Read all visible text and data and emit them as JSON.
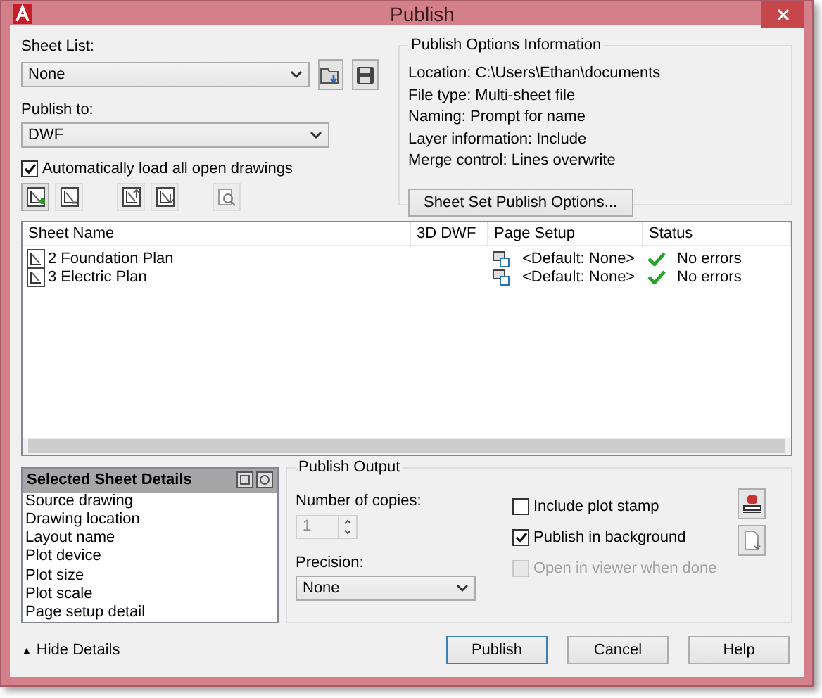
{
  "window": {
    "title": "Publish"
  },
  "sheet_list": {
    "label": "Sheet List:",
    "value": "None"
  },
  "publish_to": {
    "label": "Publish to:",
    "value": "DWF"
  },
  "auto_load": {
    "label": "Automatically load all open drawings",
    "checked": true
  },
  "options_info": {
    "title": "Publish Options Information",
    "lines": [
      "Location: C:\\Users\\Ethan\\documents",
      "File type: Multi-sheet file",
      "Naming: Prompt for name",
      "Layer information: Include",
      "Merge control: Lines overwrite"
    ],
    "button": "Sheet Set Publish Options..."
  },
  "table": {
    "columns": [
      "Sheet Name",
      "3D DWF",
      "Page Setup",
      "Status"
    ],
    "rows": [
      {
        "sheet_name": "2 Foundation Plan",
        "page_setup": "<Default: None>",
        "status": "No errors"
      },
      {
        "sheet_name": "3 Electric Plan",
        "page_setup": "<Default: None>",
        "status": "No errors"
      }
    ]
  },
  "details": {
    "title": "Selected Sheet Details",
    "items": [
      "Source drawing",
      "Drawing location",
      "Layout name",
      "Plot device",
      "Plot size",
      "Plot scale",
      "Page setup detail"
    ]
  },
  "output": {
    "title": "Publish Output",
    "copies_label": "Number of copies:",
    "copies": "1",
    "copies_disabled": true,
    "precision_label": "Precision:",
    "precision": "None",
    "options": [
      {
        "label": "Include plot stamp",
        "checked": false,
        "disabled": false
      },
      {
        "label": "Publish in background",
        "checked": true,
        "disabled": false
      },
      {
        "label": "Open in viewer when done",
        "checked": false,
        "disabled": true
      }
    ]
  },
  "hide_details": {
    "arrow": "▲",
    "label": "Hide Details"
  },
  "buttons": [
    {
      "label": "Publish",
      "default": true
    },
    {
      "label": "Cancel",
      "default": false
    },
    {
      "label": "Help",
      "default": false
    }
  ]
}
